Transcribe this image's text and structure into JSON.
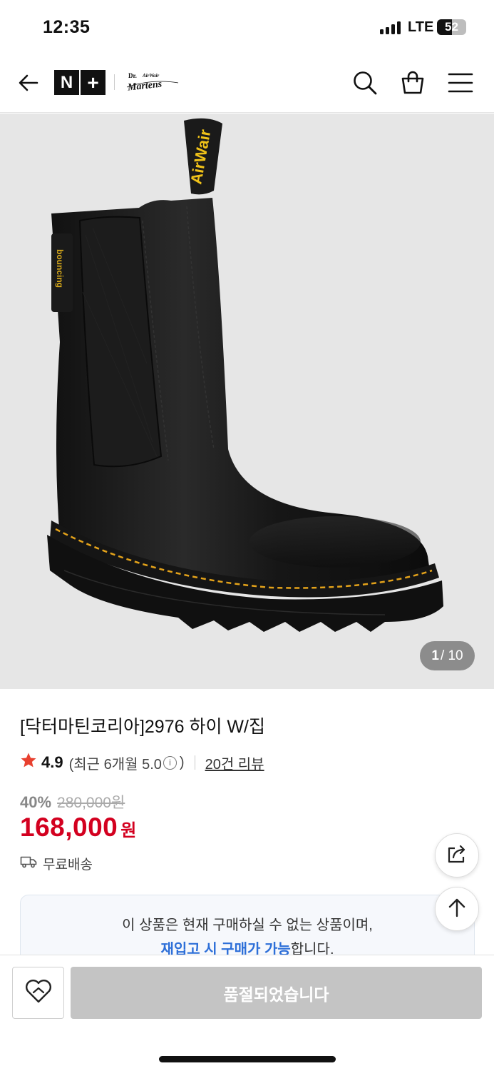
{
  "status_bar": {
    "time": "12:35",
    "network": "LTE",
    "battery": "52",
    "battery_level": 0.52
  },
  "header": {
    "store_logo": "N+",
    "brand_logo": "Dr. Martens AirWair"
  },
  "gallery": {
    "current": "1",
    "total": "/ 10"
  },
  "product": {
    "title": "[닥터마틴코리아]2976 하이 W/집",
    "rating": "4.9",
    "recent_label": "(최근 6개월 5.0",
    "recent_close": ")",
    "reviews": "20건 리뷰",
    "discount": "40%",
    "original_price": "280,000원",
    "price": "168,000",
    "currency": "원",
    "shipping": "무료배송"
  },
  "notice": {
    "line1": "이 상품은 현재 구매하실 수 없는 상품이며,",
    "highlight": "재입고 시 구매가 가능",
    "line2_suffix": "합니다."
  },
  "bottom": {
    "soldout_label": "품절되었습니다"
  },
  "colors": {
    "price": "#d3001f",
    "star": "#e8402f",
    "highlight": "#2d6fd8",
    "button_disabled": "#c4c4c4"
  },
  "icons": [
    "back-arrow-icon",
    "search-icon",
    "shopping-bag-icon",
    "menu-icon",
    "star-icon",
    "info-icon",
    "delivery-truck-icon",
    "share-icon",
    "scroll-top-icon",
    "wishlist-heart-icon"
  ]
}
